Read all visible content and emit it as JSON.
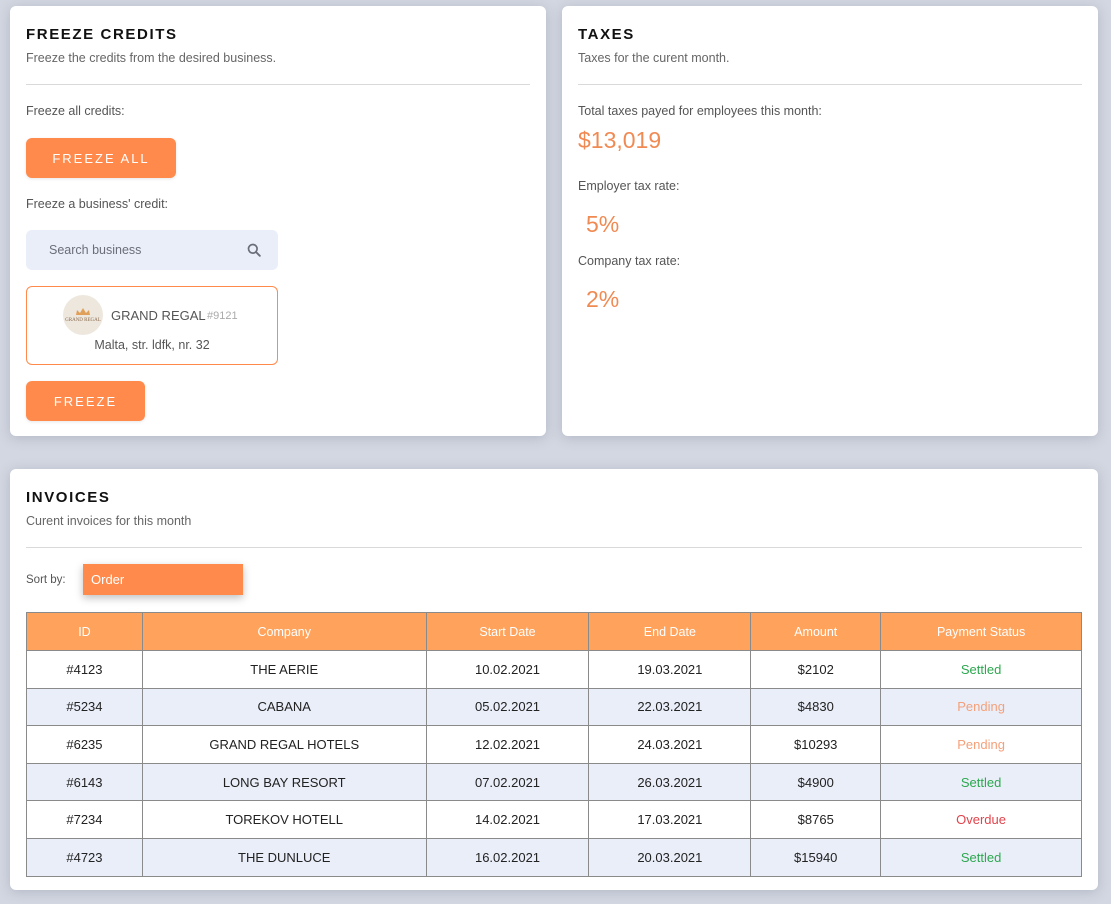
{
  "freeze_credits": {
    "title": "FREEZE CREDITS",
    "subtitle": "Freeze the credits from the desired business.",
    "freeze_all_label": "Freeze all credits:",
    "freeze_all_button": "FREEZE ALL",
    "freeze_business_label": "Freeze a business' credit:",
    "search_placeholder": "Search business",
    "business": {
      "logo_text": "GRAND REGAL",
      "name": "GRAND REGAL",
      "id": "#9121",
      "address": "Malta, str. ldfk, nr. 32"
    },
    "freeze_button": "FREEZE"
  },
  "taxes": {
    "title": "TAXES",
    "subtitle": "Taxes for the curent month.",
    "total_label": "Total taxes payed for employees this month:",
    "total_value": "$13,019",
    "employer_rate_label": "Employer tax rate:",
    "employer_rate_value": "5%",
    "company_rate_label": "Company tax rate:",
    "company_rate_value": "2%"
  },
  "invoices": {
    "title": "INVOICES",
    "subtitle": "Curent invoices for this month",
    "sort_label": "Sort by:",
    "sort_value": "Order",
    "columns": [
      "ID",
      "Company",
      "Start Date",
      "End Date",
      "Amount",
      "Payment Status"
    ],
    "rows": [
      {
        "id": "#4123",
        "company": "THE AERIE",
        "start": "10.02.2021",
        "end": "19.03.2021",
        "amount": "$2102",
        "status": "Settled"
      },
      {
        "id": "#5234",
        "company": "CABANA",
        "start": "05.02.2021",
        "end": "22.03.2021",
        "amount": "$4830",
        "status": "Pending"
      },
      {
        "id": "#6235",
        "company": "GRAND REGAL HOTELS",
        "start": "12.02.2021",
        "end": "24.03.2021",
        "amount": "$10293",
        "status": "Pending"
      },
      {
        "id": "#6143",
        "company": "LONG BAY RESORT",
        "start": "07.02.2021",
        "end": "26.03.2021",
        "amount": "$4900",
        "status": "Settled"
      },
      {
        "id": "#7234",
        "company": "TOREKOV HOTELL",
        "start": "14.02.2021",
        "end": "17.03.2021",
        "amount": "$8765",
        "status": "Overdue"
      },
      {
        "id": "#4723",
        "company": "THE DUNLUCE",
        "start": "16.02.2021",
        "end": "20.03.2021",
        "amount": "$15940",
        "status": "Settled"
      }
    ]
  },
  "colors": {
    "accent": "#ff8a4b",
    "table_header": "#ffa35c",
    "settled": "#2ca84f",
    "pending": "#f4a07a",
    "overdue": "#e0444c"
  }
}
